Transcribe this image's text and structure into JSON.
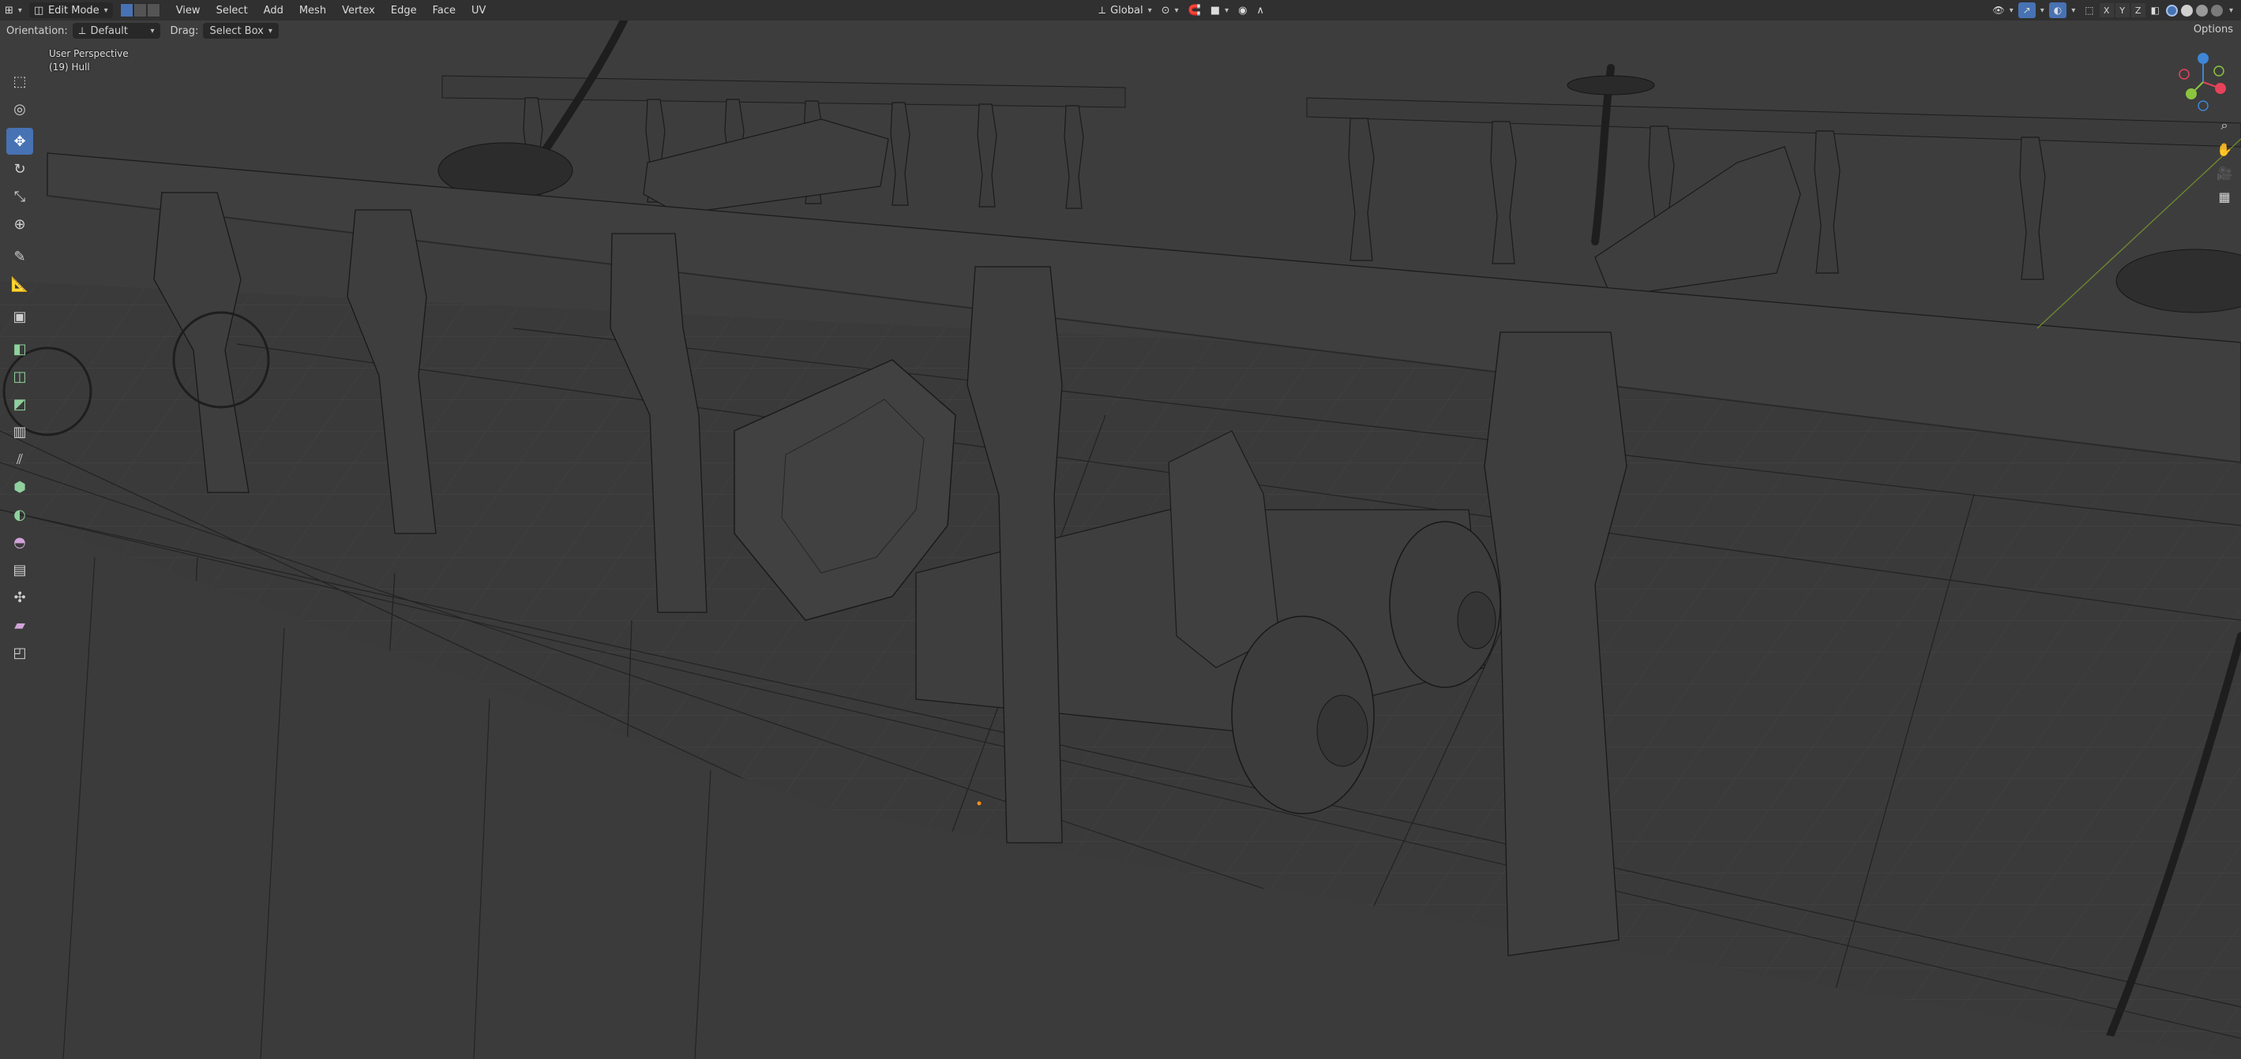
{
  "header": {
    "mode": "Edit Mode",
    "menus": [
      "View",
      "Select",
      "Add",
      "Mesh",
      "Vertex",
      "Edge",
      "Face",
      "UV"
    ],
    "transform_orientation": "Global",
    "options_label": "Options",
    "axes": [
      "X",
      "Y",
      "Z"
    ]
  },
  "tool_settings": {
    "orientation_label": "Orientation:",
    "orientation_value": "Default",
    "drag_label": "Drag:",
    "drag_value": "Select Box"
  },
  "viewport": {
    "view_name": "User Perspective",
    "object_name": "(19) Hull"
  },
  "toolbar": {
    "tools": [
      "select-box",
      "cursor",
      "move",
      "rotate",
      "scale",
      "transform",
      "annotate",
      "measure",
      "add-cube",
      "extrude-region",
      "inset-faces",
      "bevel",
      "loop-cut",
      "knife",
      "poly-build",
      "spin",
      "smooth",
      "edge-slide",
      "shrink-fatten",
      "shear",
      "rip-region"
    ],
    "active_tool": "move"
  },
  "gizmo": {
    "x_color": "#e8425a",
    "y_color": "#8bc43f",
    "z_color": "#3f86d6"
  },
  "colors": {
    "accent": "#4772b3",
    "header_bg": "#303030",
    "viewport_bg": "#3d3d3d"
  }
}
